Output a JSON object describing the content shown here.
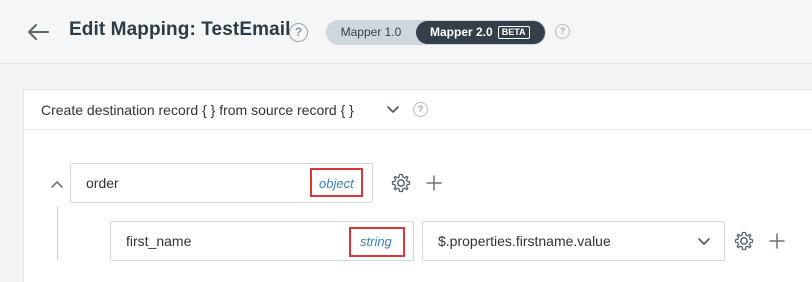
{
  "header": {
    "title": "Edit Mapping: TestEmail",
    "help_glyph": "?",
    "version_toggle": {
      "option1": "Mapper 1.0",
      "option2": "Mapper 2.0",
      "badge": "BETA",
      "selected": "Mapper 2.0"
    }
  },
  "panel": {
    "description": "Create destination record { } from source record { }"
  },
  "mapping": {
    "parent": {
      "name": "order",
      "type": "object",
      "expanded": true
    },
    "child": {
      "name": "first_name",
      "type": "string",
      "source": "$.properties.firstname.value"
    }
  },
  "colors": {
    "accent_dark": "#343f49",
    "type_text": "#3a7fc1",
    "highlight_box": "#d9383a"
  },
  "icons": [
    "back-arrow-icon",
    "help-icon",
    "chevron-down-icon",
    "chevron-up-icon",
    "gear-icon",
    "plus-icon"
  ]
}
